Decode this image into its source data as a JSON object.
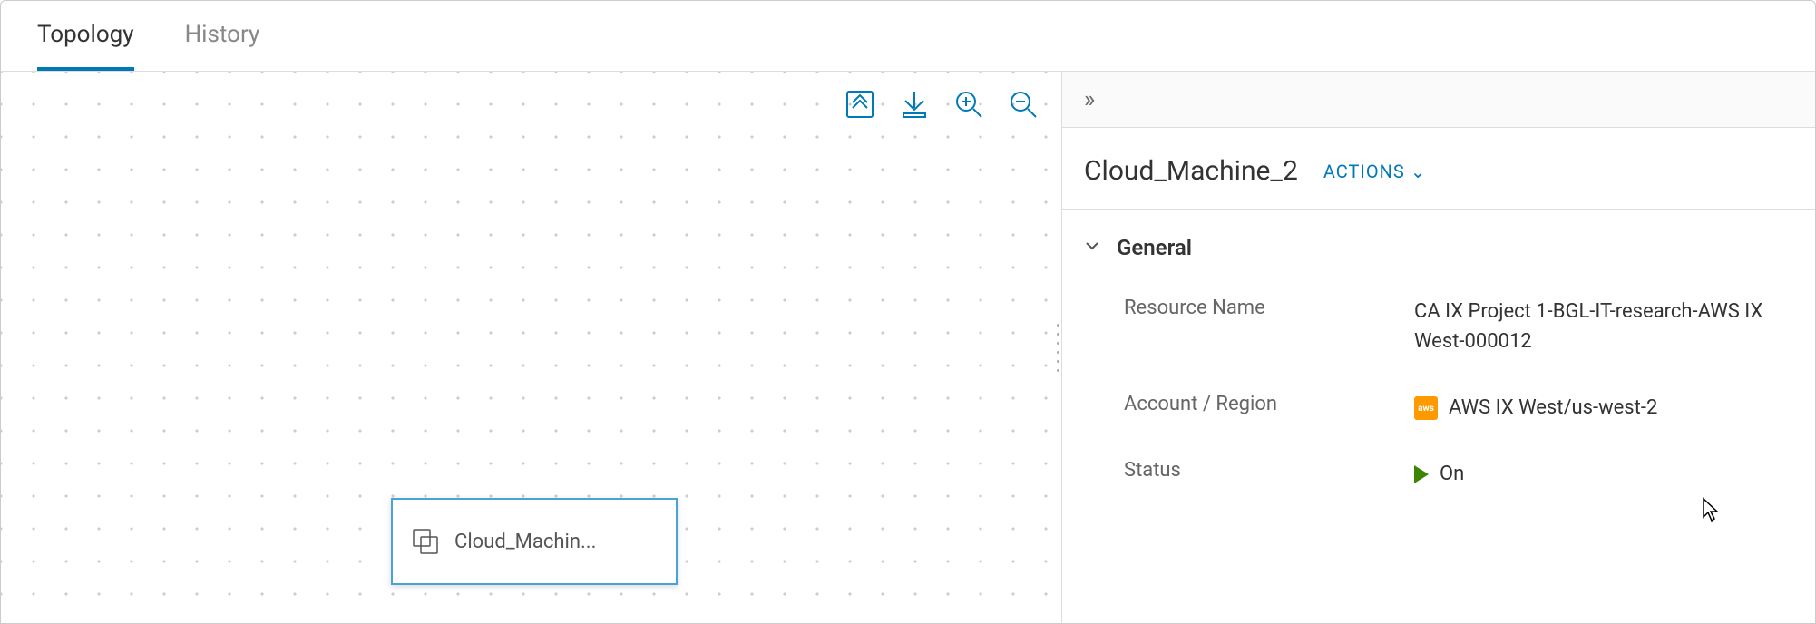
{
  "tabs": {
    "topology": "Topology",
    "history": "History"
  },
  "canvas": {
    "node_label": "Cloud_Machin..."
  },
  "panel": {
    "title": "Cloud_Machine_2",
    "actions_label": "ACTIONS",
    "section_general": "General",
    "fields": {
      "resource_name_label": "Resource Name",
      "resource_name_value": "CA IX Project 1-BGL-IT-research-AWS IX West-000012",
      "account_region_label": "Account / Region",
      "account_region_value": "AWS IX West/us-west-2",
      "status_label": "Status",
      "status_value": "On"
    }
  }
}
